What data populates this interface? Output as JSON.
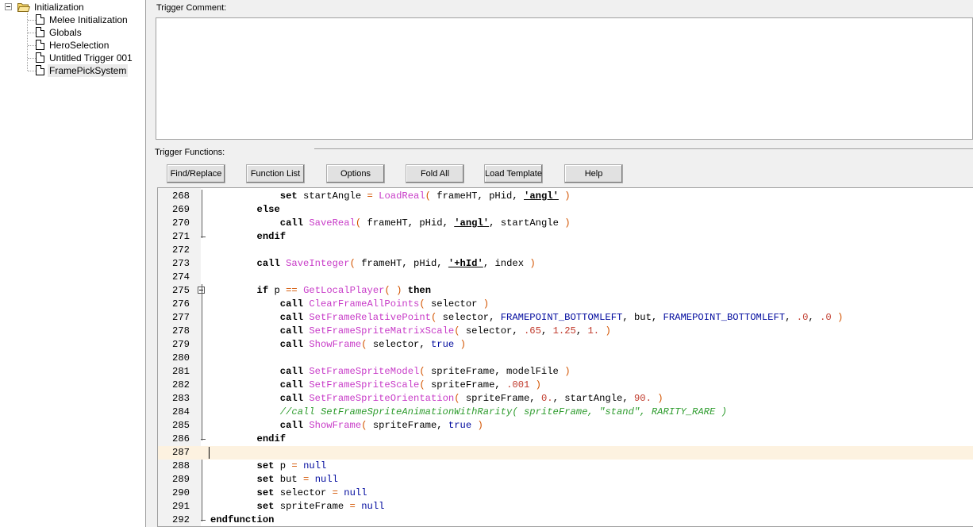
{
  "tree": {
    "root": {
      "label": "Initialization",
      "expanded": true
    },
    "items": [
      {
        "label": "Melee Initialization",
        "selected": false
      },
      {
        "label": "Globals",
        "selected": false
      },
      {
        "label": "HeroSelection",
        "selected": false
      },
      {
        "label": "Untitled Trigger 001",
        "selected": false
      },
      {
        "label": "FramePickSystem",
        "selected": true
      }
    ]
  },
  "comment": {
    "label": "Trigger Comment:",
    "value": ""
  },
  "functions": {
    "label": "Trigger Functions:",
    "toolbar": [
      "Find/Replace",
      "Function List",
      "Options",
      "Fold All",
      "Load Template",
      "Help"
    ]
  },
  "editor": {
    "current_line": 287,
    "lines": [
      {
        "n": "268",
        "tokens": [
          [
            "",
            "            "
          ],
          [
            "k",
            "set"
          ],
          [
            "id",
            " startAngle "
          ],
          [
            "op",
            "="
          ],
          [
            "id",
            " "
          ],
          [
            "fn",
            "LoadReal"
          ],
          [
            "op",
            "("
          ],
          [
            "id",
            " frameHT, pHid, "
          ],
          [
            "str",
            "'angl'"
          ],
          [
            "id",
            " "
          ],
          [
            "op",
            ")"
          ]
        ]
      },
      {
        "n": "269",
        "tokens": [
          [
            "",
            "        "
          ],
          [
            "k",
            "else"
          ]
        ]
      },
      {
        "n": "270",
        "tokens": [
          [
            "",
            "            "
          ],
          [
            "k",
            "call"
          ],
          [
            "id",
            " "
          ],
          [
            "fn",
            "SaveReal"
          ],
          [
            "op",
            "("
          ],
          [
            "id",
            " frameHT, pHid, "
          ],
          [
            "str",
            "'angl'"
          ],
          [
            "id",
            ", startAngle "
          ],
          [
            "op",
            ")"
          ]
        ]
      },
      {
        "n": "271",
        "tokens": [
          [
            "",
            "        "
          ],
          [
            "k",
            "endif"
          ]
        ]
      },
      {
        "n": "272",
        "tokens": []
      },
      {
        "n": "273",
        "tokens": [
          [
            "",
            "        "
          ],
          [
            "k",
            "call"
          ],
          [
            "id",
            " "
          ],
          [
            "fn",
            "SaveInteger"
          ],
          [
            "op",
            "("
          ],
          [
            "id",
            " frameHT, pHid, "
          ],
          [
            "str",
            "'+hId'"
          ],
          [
            "id",
            ", index "
          ],
          [
            "op",
            ")"
          ]
        ]
      },
      {
        "n": "274",
        "tokens": []
      },
      {
        "n": "275",
        "tokens": [
          [
            "",
            "        "
          ],
          [
            "k",
            "if"
          ],
          [
            "id",
            " p "
          ],
          [
            "op",
            "=="
          ],
          [
            "id",
            " "
          ],
          [
            "fn",
            "GetLocalPlayer"
          ],
          [
            "op",
            "("
          ],
          [
            "id",
            " "
          ],
          [
            "op",
            ")"
          ],
          [
            "id",
            " "
          ],
          [
            "k",
            "then"
          ]
        ]
      },
      {
        "n": "276",
        "tokens": [
          [
            "",
            "            "
          ],
          [
            "k",
            "call"
          ],
          [
            "id",
            " "
          ],
          [
            "fn",
            "ClearFrameAllPoints"
          ],
          [
            "op",
            "("
          ],
          [
            "id",
            " selector "
          ],
          [
            "op",
            ")"
          ]
        ]
      },
      {
        "n": "277",
        "tokens": [
          [
            "",
            "            "
          ],
          [
            "k",
            "call"
          ],
          [
            "id",
            " "
          ],
          [
            "fn",
            "SetFrameRelativePoint"
          ],
          [
            "op",
            "("
          ],
          [
            "id",
            " selector, "
          ],
          [
            "cst",
            "FRAMEPOINT_BOTTOMLEFT"
          ],
          [
            "id",
            ", but, "
          ],
          [
            "cst",
            "FRAMEPOINT_BOTTOMLEFT"
          ],
          [
            "id",
            ", "
          ],
          [
            "num",
            ".0"
          ],
          [
            "id",
            ", "
          ],
          [
            "num",
            ".0"
          ],
          [
            "id",
            " "
          ],
          [
            "op",
            ")"
          ]
        ]
      },
      {
        "n": "278",
        "tokens": [
          [
            "",
            "            "
          ],
          [
            "k",
            "call"
          ],
          [
            "id",
            " "
          ],
          [
            "fn",
            "SetFrameSpriteMatrixScale"
          ],
          [
            "op",
            "("
          ],
          [
            "id",
            " selector, "
          ],
          [
            "num",
            ".65"
          ],
          [
            "id",
            ", "
          ],
          [
            "num",
            "1.25"
          ],
          [
            "id",
            ", "
          ],
          [
            "num",
            "1."
          ],
          [
            "id",
            " "
          ],
          [
            "op",
            ")"
          ]
        ]
      },
      {
        "n": "279",
        "tokens": [
          [
            "",
            "            "
          ],
          [
            "k",
            "call"
          ],
          [
            "id",
            " "
          ],
          [
            "fn",
            "ShowFrame"
          ],
          [
            "op",
            "("
          ],
          [
            "id",
            " selector, "
          ],
          [
            "cst",
            "true"
          ],
          [
            "id",
            " "
          ],
          [
            "op",
            ")"
          ]
        ]
      },
      {
        "n": "280",
        "tokens": []
      },
      {
        "n": "281",
        "tokens": [
          [
            "",
            "            "
          ],
          [
            "k",
            "call"
          ],
          [
            "id",
            " "
          ],
          [
            "fn",
            "SetFrameSpriteModel"
          ],
          [
            "op",
            "("
          ],
          [
            "id",
            " spriteFrame, modelFile "
          ],
          [
            "op",
            ")"
          ]
        ]
      },
      {
        "n": "282",
        "tokens": [
          [
            "",
            "            "
          ],
          [
            "k",
            "call"
          ],
          [
            "id",
            " "
          ],
          [
            "fn",
            "SetFrameSpriteScale"
          ],
          [
            "op",
            "("
          ],
          [
            "id",
            " spriteFrame, "
          ],
          [
            "num",
            ".001"
          ],
          [
            "id",
            " "
          ],
          [
            "op",
            ")"
          ]
        ]
      },
      {
        "n": "283",
        "tokens": [
          [
            "",
            "            "
          ],
          [
            "k",
            "call"
          ],
          [
            "id",
            " "
          ],
          [
            "fn",
            "SetFrameSpriteOrientation"
          ],
          [
            "op",
            "("
          ],
          [
            "id",
            " spriteFrame, "
          ],
          [
            "num",
            "0."
          ],
          [
            "id",
            ", startAngle, "
          ],
          [
            "num",
            "90."
          ],
          [
            "id",
            " "
          ],
          [
            "op",
            ")"
          ]
        ]
      },
      {
        "n": "284",
        "tokens": [
          [
            "",
            "            "
          ],
          [
            "cm",
            "//call SetFrameSpriteAnimationWithRarity( spriteFrame, \"stand\", RARITY_RARE )"
          ]
        ]
      },
      {
        "n": "285",
        "tokens": [
          [
            "",
            "            "
          ],
          [
            "k",
            "call"
          ],
          [
            "id",
            " "
          ],
          [
            "fn",
            "ShowFrame"
          ],
          [
            "op",
            "("
          ],
          [
            "id",
            " spriteFrame, "
          ],
          [
            "cst",
            "true"
          ],
          [
            "id",
            " "
          ],
          [
            "op",
            ")"
          ]
        ]
      },
      {
        "n": "286",
        "tokens": [
          [
            "",
            "        "
          ],
          [
            "k",
            "endif"
          ]
        ]
      },
      {
        "n": "287",
        "tokens": []
      },
      {
        "n": "288",
        "tokens": [
          [
            "",
            "        "
          ],
          [
            "k",
            "set"
          ],
          [
            "id",
            " p "
          ],
          [
            "op",
            "="
          ],
          [
            "id",
            " "
          ],
          [
            "cst",
            "null"
          ]
        ]
      },
      {
        "n": "289",
        "tokens": [
          [
            "",
            "        "
          ],
          [
            "k",
            "set"
          ],
          [
            "id",
            " but "
          ],
          [
            "op",
            "="
          ],
          [
            "id",
            " "
          ],
          [
            "cst",
            "null"
          ]
        ]
      },
      {
        "n": "290",
        "tokens": [
          [
            "",
            "        "
          ],
          [
            "k",
            "set"
          ],
          [
            "id",
            " selector "
          ],
          [
            "op",
            "="
          ],
          [
            "id",
            " "
          ],
          [
            "cst",
            "null"
          ]
        ]
      },
      {
        "n": "291",
        "tokens": [
          [
            "",
            "        "
          ],
          [
            "k",
            "set"
          ],
          [
            "id",
            " spriteFrame "
          ],
          [
            "op",
            "="
          ],
          [
            "id",
            " "
          ],
          [
            "cst",
            "null"
          ]
        ]
      },
      {
        "n": "292",
        "tokens": [
          [
            "k",
            "endfunction"
          ]
        ]
      }
    ]
  }
}
